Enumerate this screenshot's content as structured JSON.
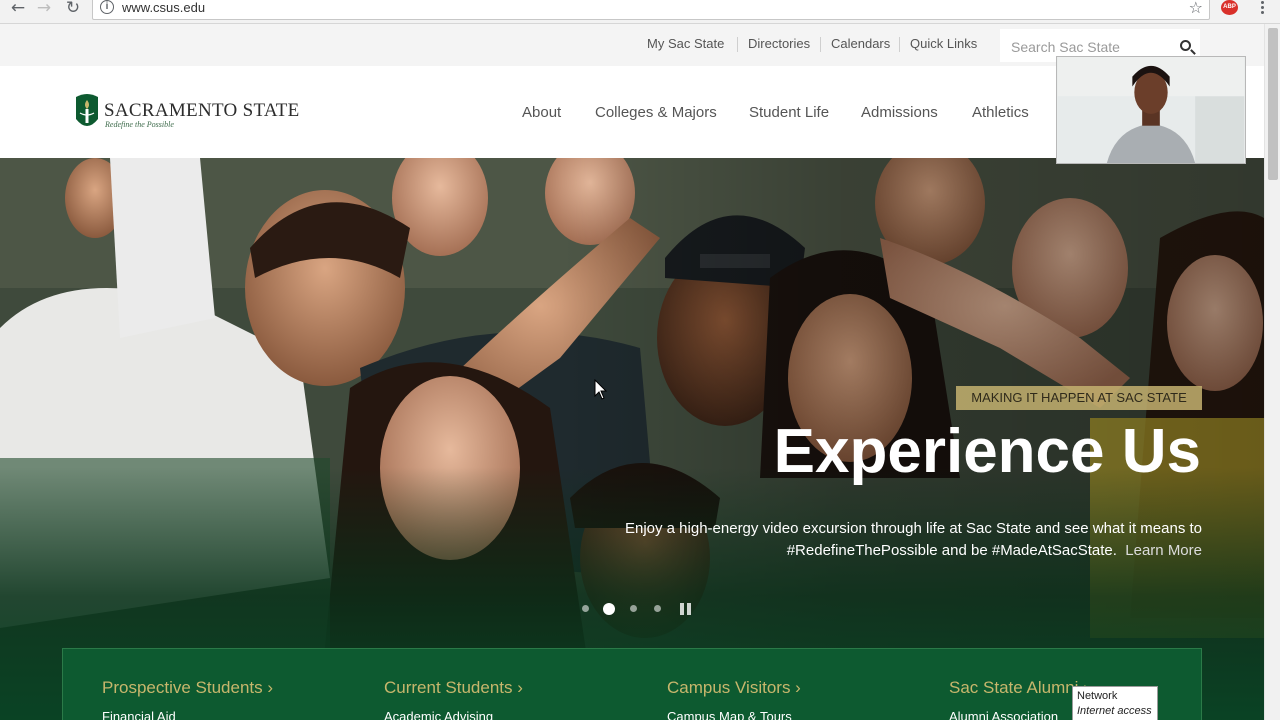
{
  "browser": {
    "url": "www.csus.edu"
  },
  "utility_links": [
    "My Sac State",
    "Directories",
    "Calendars",
    "Quick Links"
  ],
  "search": {
    "placeholder": "Search Sac State"
  },
  "logo": {
    "name": "SACRAMENTO STATE",
    "tagline": "Redefine the Possible"
  },
  "main_nav": [
    "About",
    "Colleges & Majors",
    "Student Life",
    "Admissions",
    "Athletics"
  ],
  "hero": {
    "eyebrow": "MAKING IT HAPPEN AT SAC STATE",
    "headline": "Experience Us",
    "body": "Enjoy a high-energy video excursion through life at Sac State and see what it means to #RedefineThePossible and be #MadeAtSacState.",
    "link": "Learn More",
    "slide_count": 4,
    "active_slide": 2
  },
  "audiences": [
    {
      "title": "Prospective Students",
      "first_link": "Financial Aid"
    },
    {
      "title": "Current Students",
      "first_link": "Academic Advising"
    },
    {
      "title": "Campus Visitors",
      "first_link": "Campus Map & Tours"
    },
    {
      "title": "Sac State Alumni",
      "first_link": "Alumni Association"
    }
  ],
  "tooltip": {
    "line1": "Network",
    "line2": "Internet access"
  },
  "colors": {
    "brand_green": "#0d5a30",
    "gold": "#c7b66c",
    "eyebrow_bg": "#c4b270"
  }
}
